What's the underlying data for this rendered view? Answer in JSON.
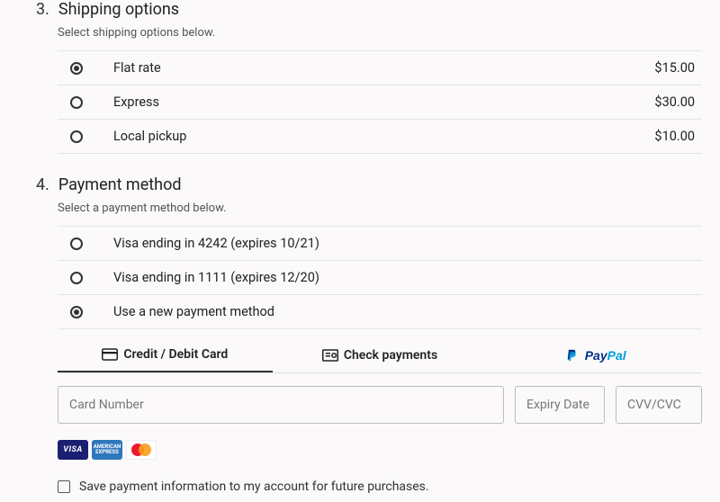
{
  "shipping": {
    "number": "3.",
    "title": "Shipping options",
    "subtitle": "Select shipping options below.",
    "options": [
      {
        "label": "Flat rate",
        "price": "$15.00",
        "selected": true
      },
      {
        "label": "Express",
        "price": "$30.00",
        "selected": false
      },
      {
        "label": "Local pickup",
        "price": "$10.00",
        "selected": false
      }
    ]
  },
  "payment": {
    "number": "4.",
    "title": "Payment method",
    "subtitle": "Select a payment method below.",
    "options": [
      {
        "label": "Visa ending in 4242 (expires 10/21)",
        "selected": false
      },
      {
        "label": "Visa ending in 1111 (expires 12/20)",
        "selected": false
      },
      {
        "label": "Use a new payment method",
        "selected": true
      }
    ],
    "tabs": {
      "card": "Credit / Debit Card",
      "check": "Check payments",
      "paypal_pay": "Pay",
      "paypal_pal": "Pal"
    },
    "fields": {
      "card_number": "Card Number",
      "expiry": "Expiry Date",
      "cvc": "CVV/CVC"
    },
    "brands": {
      "visa": "VISA",
      "amex": "AMERICAN EXPRESS"
    },
    "save_label": "Save payment information to my account for future purchases."
  }
}
